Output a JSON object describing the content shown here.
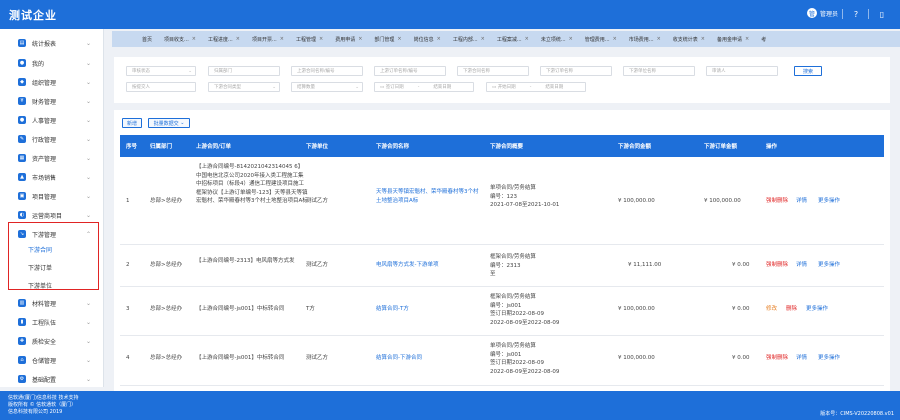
{
  "header": {
    "brand": "测试企业",
    "user": "管理员",
    "avatar_char": "管"
  },
  "sidebar": {
    "items": [
      {
        "label": "统计报表",
        "icon": "chart-icon"
      },
      {
        "label": "我的",
        "icon": "user-icon"
      },
      {
        "label": "组织管理",
        "icon": "org-icon"
      },
      {
        "label": "财务管理",
        "icon": "finance-icon"
      },
      {
        "label": "人事管理",
        "icon": "hr-icon"
      },
      {
        "label": "行政管理",
        "icon": "admin-icon"
      },
      {
        "label": "资产管理",
        "icon": "asset-icon"
      },
      {
        "label": "市场销售",
        "icon": "market-icon"
      },
      {
        "label": "项目管理",
        "icon": "project-icon"
      },
      {
        "label": "运营商项目",
        "icon": "operator-icon"
      },
      {
        "label": "下游管理",
        "icon": "downstream-icon"
      }
    ],
    "sub_items": [
      "下游合同",
      "下游订单",
      "下游单位"
    ],
    "items_after": [
      {
        "label": "材料管理",
        "icon": "material-icon"
      },
      {
        "label": "工程队伍",
        "icon": "team-icon"
      },
      {
        "label": "质检安全",
        "icon": "safety-icon"
      },
      {
        "label": "仓储管理",
        "icon": "warehouse-icon"
      },
      {
        "label": "基础配置",
        "icon": "config-icon"
      }
    ]
  },
  "tabs": [
    "首页",
    "项目收支...",
    "工程进度...",
    "项目开票...",
    "工程管理",
    "费用申请",
    "部门管理",
    "岗位信息",
    "工程内部...",
    "工程案减...",
    "未立项统...",
    "管理费用...",
    "市场费用...",
    "收支统计表",
    "备用金申请",
    "考"
  ],
  "filters": {
    "row1": [
      "审核状态",
      "归属部门",
      "上游合同名称/编号",
      "上游订单名称/编号",
      "下游合同名称",
      "下游订单名称",
      "下游单位名称",
      "审请人"
    ],
    "row2": [
      "按提交人",
      "下游合同类型",
      "结算数量",
      "签订日期",
      "-",
      "结束日期",
      "开始日期",
      "-",
      "结束日期"
    ],
    "search": "搜索"
  },
  "actions": {
    "add": "新增",
    "batch": "批量数据交"
  },
  "table": {
    "columns": [
      "序号",
      "归属部门",
      "上游合同/订单",
      "下游单位",
      "下游合同名称",
      "下游合同概要",
      "下游合同金额",
      "下游订单金额",
      "操作"
    ],
    "rows": [
      {
        "no": "1",
        "dept": "总部>总经办",
        "upstream": "【上游合同编号-8142021042314045 6】中国电信北京公司2020年接入类工程施工集中招标项目（标段4）通信工程建设项目施工框架协议【上游订单编号-123】天等县天等镇宏魁村、荣华殿春村等3个村土地整治项目A标",
        "unit": "测试乙方",
        "name": "天等县天等镇宏魁村、荣华殿春村等3个村土地整治项目A标",
        "summary": "单项合同/劳务结算\n编号：123\n2021-07-08至2021-10-01",
        "amount": "¥ 100,000.00",
        "order_amount": "¥ 100,000.00",
        "ops": [
          "强制删除",
          "详情",
          "更多操作"
        ]
      },
      {
        "no": "2",
        "dept": "总部>总经办",
        "upstream": "【上游合同编号-2313】电风扇等方式发",
        "unit": "测试乙方",
        "name": "电风扇等方式发-下游单项",
        "summary": "框架合同/劳务结算\n编号：2313\n至",
        "amount": "¥ 11,111.00",
        "order_amount": "¥ 0.00",
        "ops": [
          "强制删除",
          "详情",
          "更多操作"
        ]
      },
      {
        "no": "3",
        "dept": "总部>总经办",
        "upstream": "【上游合同编号-js001】中标转合同",
        "unit": "T方",
        "name": "结算合同-T方",
        "summary": "框架合同/劳务结算\n编号：js001\n签订日期2022-08-09\n2022-08-09至2022-08-09",
        "amount": "¥ 100,000.00",
        "order_amount": "¥ 0.00",
        "ops": [
          "修改",
          "删除",
          "更多操作"
        ]
      },
      {
        "no": "4",
        "dept": "总部>总经办",
        "upstream": "【上游合同编号-js001】中标转合同",
        "unit": "测试乙方",
        "name": "结算合同-下游合同",
        "summary": "单项合同/劳务结算\n编号：js001\n签订日期2022-08-09\n2022-08-09至2022-08-09",
        "amount": "¥ 100,000.00",
        "order_amount": "¥ 0.00",
        "ops": [
          "强制删除",
          "详情",
          "更多操作"
        ]
      }
    ]
  },
  "footer": {
    "lines": [
      "信软通(厦门)信息科技 技术支持",
      "版权所有 © 信软通软（厦门）",
      "信息科技有限公司 2019"
    ],
    "version": "版本号：CIMS-V20220808.v01"
  },
  "colors": {
    "primary": "#1e6fd9",
    "danger": "#e02424",
    "tab_bg": "#c7d9f0"
  }
}
